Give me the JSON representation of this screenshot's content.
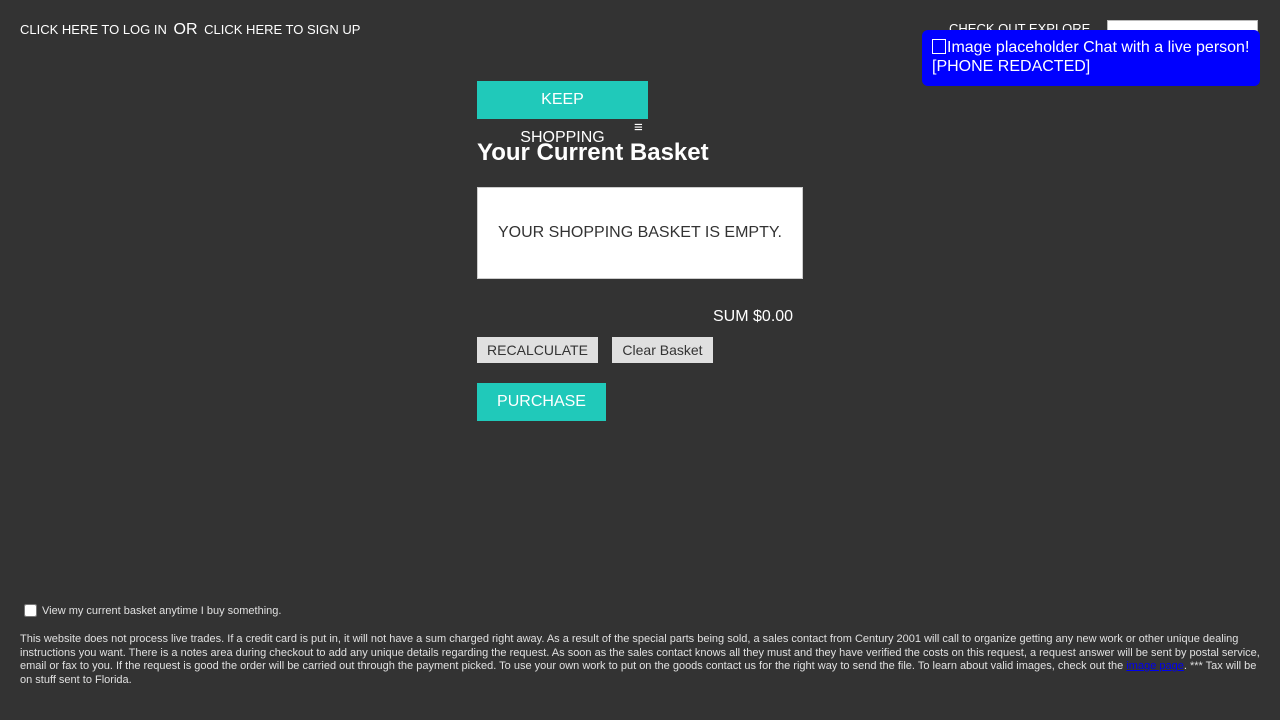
{
  "auth": {
    "login_label": "CLICK HERE TO LOG IN",
    "or_label": "OR",
    "signup_label": "CLICK HERE TO SIGN UP"
  },
  "header": {
    "explore_label": "CHECK OUT EXPLORE",
    "search_value": ""
  },
  "chat": {
    "icon": "broken-image-icon",
    "alt_text": "Image placeholder",
    "label": "Chat with a live person!",
    "phone": "[PHONE REDACTED]",
    "bg_color": "#0000ff"
  },
  "basket": {
    "keep_shopping_label": "KEEP SHOPPING",
    "menu_icon": "≡",
    "title": "Your Current Basket",
    "empty_message": "YOUR SHOPPING BASKET IS EMPTY.",
    "sum_label": "SUM",
    "sum_value": "$0.00",
    "recalculate_label": "RECALCULATE",
    "clear_label": "Clear Basket",
    "purchase_label": "PURCHASE",
    "accent_color": "#20c9ba"
  },
  "footer": {
    "optin_checked": false,
    "optin_label": "View my current basket anytime I buy something.",
    "disclaimer_before_link": "This website does not process live trades. If a credit card is put in, it will not have a sum charged right away. As a result of the special parts being sold, a sales contact from Century 2001 will call to organize getting any new work or other unique dealing instructions you want. There is a notes area during checkout to add any unique details regarding the request. As soon as the sales contact knows all they must and they have verified the costs on this request, a request answer will be sent by postal service, email or fax to you. If the request is good the order will be carried out through the payment picked. To use your own work to put on the goods contact us for the right way to send the file. To learn about valid images, check out the",
    "disclaimer_link": "image page",
    "disclaimer_after_link": ". *** Tax will be on stuff sent to Florida."
  }
}
